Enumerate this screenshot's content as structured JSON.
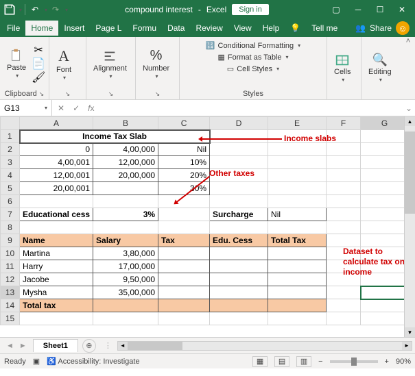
{
  "title": {
    "filename": "compound interest",
    "app": "Excel",
    "signin": "Sign in"
  },
  "menu": {
    "file": "File",
    "home": "Home",
    "insert": "Insert",
    "pageL": "Page L",
    "formu": "Formu",
    "data": "Data",
    "review": "Review",
    "view": "View",
    "help": "Help",
    "tellme": "Tell me",
    "share": "Share"
  },
  "ribbon": {
    "clipboard": "Clipboard",
    "paste": "Paste",
    "font": "Font",
    "alignment": "Alignment",
    "number": "Number",
    "cond": "Conditional Formatting",
    "table": "Format as Table",
    "cellstyles": "Cell Styles",
    "styles": "Styles",
    "cells": "Cells",
    "editing": "Editing"
  },
  "namebox": "G13",
  "formula": "",
  "cols": [
    "A",
    "B",
    "C",
    "D",
    "E",
    "F"
  ],
  "widths": [
    85,
    95,
    75,
    85,
    85,
    50
  ],
  "rows": [
    {
      "n": 1,
      "cells": [
        {
          "v": "Income Tax Slab",
          "span": 3,
          "cls": "c hdr-slab thick-outer"
        },
        {
          "v": ""
        },
        {
          "v": ""
        },
        {
          "v": ""
        }
      ]
    },
    {
      "n": 2,
      "cells": [
        {
          "v": "0"
        },
        {
          "v": "4,00,000"
        },
        {
          "v": "Nil"
        },
        {
          "v": ""
        },
        {
          "v": ""
        },
        {
          "v": ""
        }
      ]
    },
    {
      "n": 3,
      "cells": [
        {
          "v": "4,00,001"
        },
        {
          "v": "12,00,000"
        },
        {
          "v": "10%"
        },
        {
          "v": ""
        },
        {
          "v": ""
        },
        {
          "v": ""
        }
      ]
    },
    {
      "n": 4,
      "cells": [
        {
          "v": "12,00,001"
        },
        {
          "v": "20,00,000"
        },
        {
          "v": "20%"
        },
        {
          "v": ""
        },
        {
          "v": ""
        },
        {
          "v": ""
        }
      ]
    },
    {
      "n": 5,
      "cells": [
        {
          "v": "20,00,001"
        },
        {
          "v": ""
        },
        {
          "v": "30%"
        },
        {
          "v": ""
        },
        {
          "v": ""
        },
        {
          "v": ""
        }
      ]
    },
    {
      "n": 6,
      "cells": [
        {
          "v": ""
        },
        {
          "v": ""
        },
        {
          "v": ""
        },
        {
          "v": ""
        },
        {
          "v": ""
        },
        {
          "v": ""
        }
      ]
    },
    {
      "n": 7,
      "cells": [
        {
          "v": "Educational cess",
          "cls": "l",
          "b": true
        },
        {
          "v": "3%",
          "b": true
        },
        {
          "v": ""
        },
        {
          "v": "Surcharge",
          "cls": "l",
          "b": true
        },
        {
          "v": "Nil",
          "cls": "l"
        },
        {
          "v": ""
        }
      ]
    },
    {
      "n": 8,
      "cells": [
        {
          "v": ""
        },
        {
          "v": ""
        },
        {
          "v": ""
        },
        {
          "v": ""
        },
        {
          "v": ""
        },
        {
          "v": ""
        }
      ]
    },
    {
      "n": 9,
      "cells": [
        {
          "v": "Name",
          "cls": "l peach"
        },
        {
          "v": "Salary",
          "cls": "l peach"
        },
        {
          "v": "Tax",
          "cls": "l peach"
        },
        {
          "v": "Edu. Cess",
          "cls": "l peach"
        },
        {
          "v": "Total Tax",
          "cls": "l peach"
        },
        {
          "v": ""
        }
      ]
    },
    {
      "n": 10,
      "cells": [
        {
          "v": "Martina",
          "cls": "l"
        },
        {
          "v": "3,80,000"
        },
        {
          "v": ""
        },
        {
          "v": ""
        },
        {
          "v": ""
        },
        {
          "v": ""
        }
      ]
    },
    {
      "n": 11,
      "cells": [
        {
          "v": "Harry",
          "cls": "l"
        },
        {
          "v": "17,00,000"
        },
        {
          "v": ""
        },
        {
          "v": ""
        },
        {
          "v": ""
        },
        {
          "v": ""
        }
      ]
    },
    {
      "n": 12,
      "cells": [
        {
          "v": "Jacobe",
          "cls": "l"
        },
        {
          "v": "9,50,000"
        },
        {
          "v": ""
        },
        {
          "v": ""
        },
        {
          "v": ""
        },
        {
          "v": ""
        }
      ]
    },
    {
      "n": 13,
      "cells": [
        {
          "v": "Mysha",
          "cls": "l"
        },
        {
          "v": "35,00,000"
        },
        {
          "v": ""
        },
        {
          "v": ""
        },
        {
          "v": ""
        },
        {
          "v": ""
        }
      ]
    },
    {
      "n": 14,
      "cells": [
        {
          "v": "Total tax",
          "cls": "l peach"
        },
        {
          "v": "",
          "cls": "peach"
        },
        {
          "v": "",
          "cls": "peach"
        },
        {
          "v": "",
          "cls": "peach"
        },
        {
          "v": "",
          "cls": "peach"
        },
        {
          "v": ""
        }
      ]
    },
    {
      "n": 15,
      "cells": [
        {
          "v": ""
        },
        {
          "v": ""
        },
        {
          "v": ""
        },
        {
          "v": ""
        },
        {
          "v": ""
        },
        {
          "v": ""
        }
      ]
    }
  ],
  "annotations": {
    "a1": "Income slabs",
    "a2": "Other taxes",
    "a3": "Dataset to calculate tax on income"
  },
  "selected": {
    "row": 13,
    "col": "G"
  },
  "sheetTab": "Sheet1",
  "status": {
    "ready": "Ready",
    "access": "Accessibility: Investigate",
    "zoom": "90%"
  }
}
